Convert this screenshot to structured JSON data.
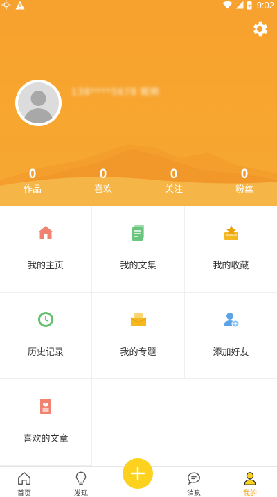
{
  "status_bar": {
    "time": "9:02",
    "icons": [
      "sun-icon",
      "warning-icon",
      "wifi-icon",
      "signal-icon",
      "battery-charging-icon"
    ]
  },
  "profile": {
    "username": "138****5678 昵称",
    "settings_icon": "gear-icon",
    "avatar_icon": "default-avatar-icon"
  },
  "stats": [
    {
      "value": "0",
      "label": "作品"
    },
    {
      "value": "0",
      "label": "喜欢"
    },
    {
      "value": "0",
      "label": "关注"
    },
    {
      "value": "0",
      "label": "粉丝"
    }
  ],
  "menu": [
    {
      "label": "我的主页",
      "icon": "home-icon",
      "color": "#f0826f"
    },
    {
      "label": "我的文集",
      "icon": "notebook-icon",
      "color": "#6cc57e"
    },
    {
      "label": "我的收藏",
      "icon": "star-box-icon",
      "color": "#f5b81e"
    },
    {
      "label": "历史记录",
      "icon": "clock-icon",
      "color": "#64c16e"
    },
    {
      "label": "我的专题",
      "icon": "envelope-icon",
      "color": "#f5b81e"
    },
    {
      "label": "添加好友",
      "icon": "add-friend-icon",
      "color": "#5aa3e8"
    },
    {
      "label": "喜欢的文章",
      "icon": "heart-document-icon",
      "color": "#f0826f"
    }
  ],
  "bottom_nav": {
    "items": [
      {
        "label": "首页",
        "icon": "home-outline-icon"
      },
      {
        "label": "发现",
        "icon": "lightbulb-icon"
      },
      {
        "label": "消息",
        "icon": "chat-bubble-icon"
      },
      {
        "label": "我的",
        "icon": "person-icon"
      }
    ],
    "active_index": 3,
    "fab_icon": "plus-icon",
    "accent_color": "#f5a623",
    "fab_color": "#fcd21f"
  }
}
